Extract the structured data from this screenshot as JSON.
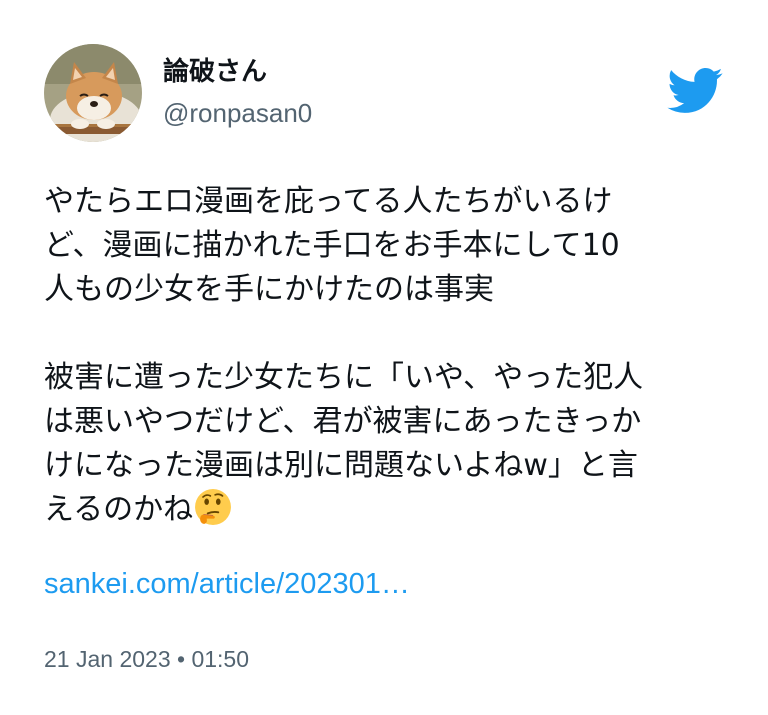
{
  "author": {
    "display_name": "論破さん",
    "handle": "@ronpasan0",
    "avatar": "shiba-dog-photo"
  },
  "brand": {
    "icon": "twitter-bird-icon",
    "color": "#1d9bf0"
  },
  "tweet": {
    "lines": [
      "やたらエロ漫画を庇ってる人たちがいるけ",
      "ど、漫画に描かれた手口をお手本にして10",
      "人もの少女を手にかけたのは事実",
      "",
      "被害に遭った少女たちに「いや、やった犯人",
      "は悪いやつだけど、君が被害にあったきっか",
      "けになった漫画は別に問題ないよねw」と言",
      "えるのかね"
    ],
    "emoji": "thinking-face-emoji",
    "link_text": "sankei.com/article/202301…",
    "timestamp": "21 Jan 2023 • 01:50"
  },
  "colors": {
    "text": "#0f1419",
    "secondary": "#536471",
    "link": "#1d9bf0"
  }
}
